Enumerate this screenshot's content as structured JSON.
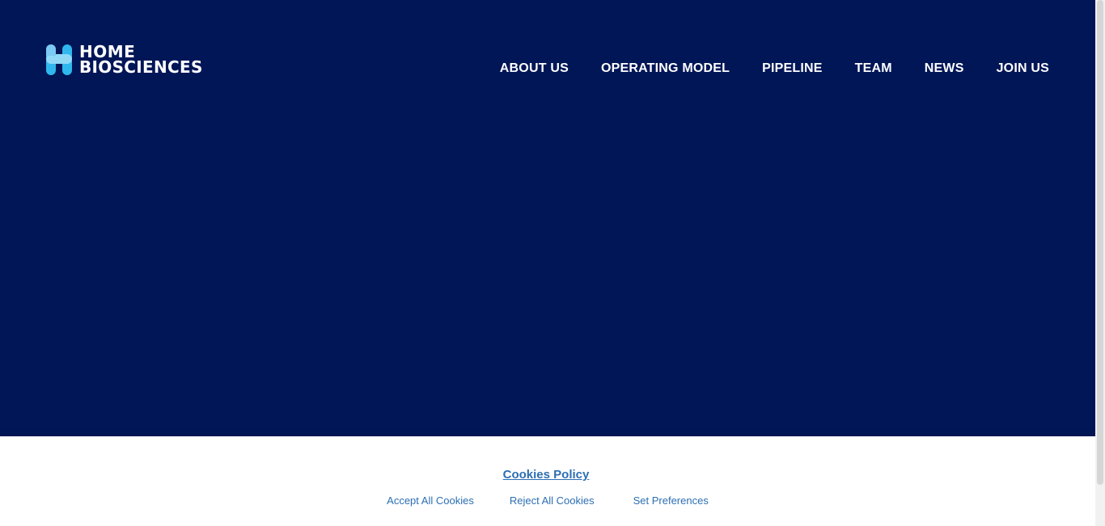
{
  "brand": {
    "line1": "HOME",
    "line2": "BIOSCIENCES",
    "colors": {
      "background": "#001657",
      "logo_primary": "#2fb8ee",
      "logo_secondary": "#8fd9f7",
      "link": "#2c6fb3"
    }
  },
  "nav": {
    "items": [
      {
        "label": "ABOUT US"
      },
      {
        "label": "OPERATING MODEL"
      },
      {
        "label": "PIPELINE"
      },
      {
        "label": "TEAM"
      },
      {
        "label": "NEWS"
      },
      {
        "label": "JOIN US"
      }
    ]
  },
  "cookie_bar": {
    "title": "Cookies Policy",
    "accept_label": "Accept All Cookies",
    "reject_label": "Reject All Cookies",
    "preferences_label": "Set Preferences"
  }
}
